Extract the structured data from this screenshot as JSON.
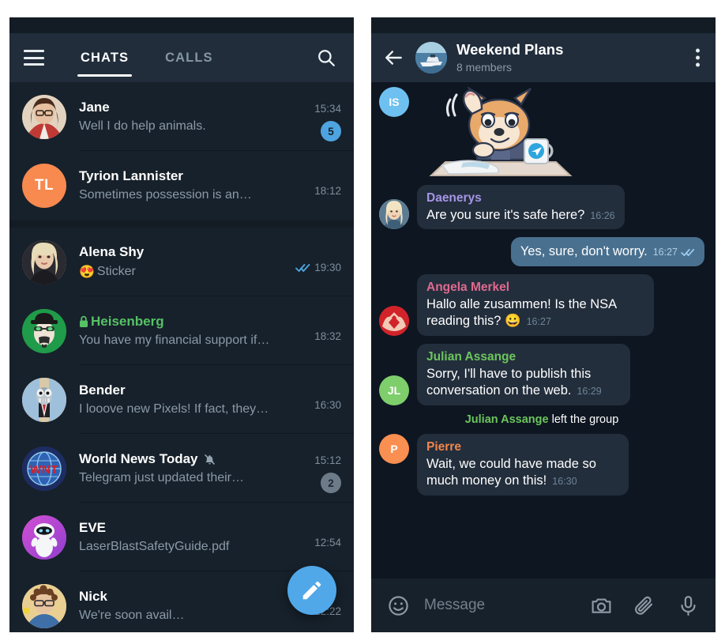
{
  "app": {
    "name": "Telegram",
    "theme": "dark"
  },
  "colors": {
    "panel_bg": "#17212b",
    "header_bg": "#212d3b",
    "chat_bg": "#0e1621",
    "bubble_in": "#232e3c",
    "bubble_out": "#49708f",
    "accent": "#50a8e8",
    "secret_green": "#55c265",
    "badge_blue": "#4ea4e0",
    "badge_muted": "#6d7b88"
  },
  "chatlist": {
    "menu_icon": "hamburger-menu-icon",
    "search_icon": "search-icon",
    "tabs": [
      {
        "label": "CHATS",
        "active": true
      },
      {
        "label": "CALLS",
        "active": false
      }
    ],
    "fab": {
      "icon": "pencil-icon",
      "label": "New message"
    },
    "items": [
      {
        "name": "Jane",
        "preview": "Well I do help animals.",
        "time": "15:34",
        "badge": "5",
        "badge_muted": false,
        "avatar_type": "photo",
        "avatar_kind": "woman-glasses",
        "initials": "",
        "avatar_color": "#c8a07c",
        "secret": false,
        "muted": false,
        "read_ticks": false
      },
      {
        "name": "Tyrion Lannister",
        "preview": "Sometimes possession is an…",
        "time": "18:12",
        "badge": "",
        "badge_muted": false,
        "avatar_type": "initials",
        "avatar_kind": "",
        "initials": "TL",
        "avatar_color": "#f8894f",
        "secret": false,
        "muted": false,
        "read_ticks": false
      },
      {
        "name": "Alena Shy",
        "preview": "Sticker",
        "preview_emoji": "😍",
        "time": "19:30",
        "badge": "",
        "badge_muted": false,
        "avatar_type": "photo",
        "avatar_kind": "blonde-woman",
        "initials": "",
        "avatar_color": "#d8cdbe",
        "secret": false,
        "muted": false,
        "read_ticks": true
      },
      {
        "name": "Heisenberg",
        "preview": "You have my financial support if…",
        "time": "18:32",
        "badge": "",
        "badge_muted": false,
        "avatar_type": "photo",
        "avatar_kind": "heisenberg",
        "initials": "",
        "avatar_color": "#23a24d",
        "secret": true,
        "muted": false,
        "read_ticks": false
      },
      {
        "name": "Bender",
        "preview": "I looove new Pixels! If fact, they…",
        "time": "16:30",
        "badge": "",
        "badge_muted": false,
        "avatar_type": "photo",
        "avatar_kind": "bender",
        "initials": "",
        "avatar_color": "#a9c0d4",
        "secret": false,
        "muted": false,
        "read_ticks": false
      },
      {
        "name": "World News Today",
        "preview": "Telegram just updated their…",
        "time": "15:12",
        "badge": "2",
        "badge_muted": true,
        "avatar_type": "photo",
        "avatar_kind": "wnt-globe",
        "initials": "",
        "avatar_color": "#2b4b8f",
        "secret": false,
        "muted": true,
        "read_ticks": false
      },
      {
        "name": "EVE",
        "preview": "LaserBlastSafetyGuide.pdf",
        "time": "12:54",
        "badge": "",
        "badge_muted": false,
        "avatar_type": "photo",
        "avatar_kind": "eve-robot",
        "initials": "",
        "avatar_color": "#c44ec4",
        "secret": false,
        "muted": false,
        "read_ticks": false
      },
      {
        "name": "Nick",
        "preview": "We're soon avail…",
        "time": "12:22",
        "badge": "",
        "badge_muted": false,
        "avatar_type": "photo",
        "avatar_kind": "nick-guy",
        "initials": "",
        "avatar_color": "#e8c98a",
        "secret": false,
        "muted": false,
        "read_ticks": false
      }
    ]
  },
  "chat": {
    "back_icon": "back-arrow-icon",
    "menu_icon": "kebab-menu-icon",
    "title": "Weekend Plans",
    "subtitle": "8 members",
    "avatar_kind": "boat-photo",
    "messages": [
      {
        "type": "sticker",
        "avatar_initials": "IS",
        "avatar_color": "#6ec0f0",
        "sticker": "shiba-inu-at-desk"
      },
      {
        "type": "in",
        "sender": "Daenerys",
        "sender_color": "#a695e7",
        "avatar_type": "photo",
        "avatar_kind": "daenerys",
        "avatar_color": "#b9a98f",
        "avatar_initials": "",
        "text": "Are you sure it's safe here?",
        "time": "16:26"
      },
      {
        "type": "out",
        "sender": "",
        "text": "Yes, sure, don't worry.",
        "time": "16:27",
        "read_ticks": true
      },
      {
        "type": "in",
        "sender": "Angela Merkel",
        "sender_color": "#e06a8f",
        "avatar_type": "photo",
        "avatar_kind": "merkel-raute",
        "avatar_color": "#d2232a",
        "avatar_initials": "",
        "text": "Hallo alle zusammen! Is the NSA reading this? 😀",
        "time": "16:27"
      },
      {
        "type": "in",
        "sender": "Julian Assange",
        "sender_color": "#6cc55d",
        "avatar_type": "initials",
        "avatar_kind": "",
        "avatar_color": "#7ece6c",
        "avatar_initials": "JL",
        "text": "Sorry, I'll have to publish this conversation on the web.",
        "time": "16:29"
      },
      {
        "type": "service",
        "actor": "Julian Assange",
        "action": "left the group"
      },
      {
        "type": "in",
        "sender": "Pierre",
        "sender_color": "#f0864c",
        "avatar_type": "initials",
        "avatar_kind": "",
        "avatar_color": "#f98f50",
        "avatar_initials": "P",
        "text": "Wait, we could have made so much money on this!",
        "time": "16:30"
      }
    ],
    "input": {
      "emoji_icon": "smiley-icon",
      "placeholder": "Message",
      "value": "",
      "camera_icon": "camera-icon",
      "attach_icon": "paperclip-icon",
      "mic_icon": "microphone-icon"
    }
  }
}
